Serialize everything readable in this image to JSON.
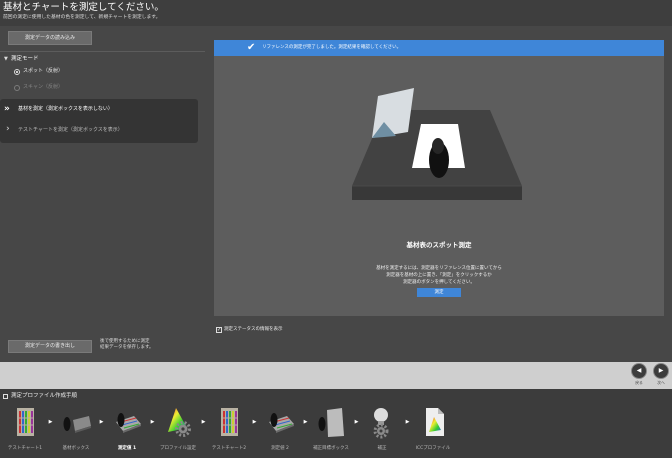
{
  "header": {
    "title": "基材とチャートを測定してください。",
    "subtitle": "前回の測定に使用した基材の色を測定して、新規チャートを測定します。"
  },
  "sidebar": {
    "load_button": "測定データの読み込み",
    "mode_section": {
      "title": "測定モード",
      "icon": "collapse-triangle-icon"
    },
    "modes": [
      {
        "label": "スポット（反射）",
        "selected": true,
        "enabled": true
      },
      {
        "label": "スキャン（反射）",
        "selected": false,
        "enabled": false
      }
    ],
    "tasks": [
      {
        "label": "基材を測定（測定ボックスを表示しない）",
        "icon": "double-chevron-right-icon",
        "active": true
      },
      {
        "label": "テストチャートを測定（測定ボックスを表示）",
        "icon": "chevron-right-icon",
        "active": false
      }
    ],
    "export_button": "測定データの書き出し",
    "export_note": [
      "後で使用するために測定",
      "結果データを保存します。"
    ]
  },
  "main": {
    "banner": {
      "icon": "check-icon",
      "text": "リファレンスの測定が完了しました。測定結果を確認してください。"
    },
    "illustration_icon": "substrate-measurement-illustration",
    "instruction": {
      "title": "基材表のスポット測定",
      "lines": [
        "基材を測定するには、測定器をリファレンス位置に置いてから",
        "測定器を基材の上に置き、「測定」をクリックするか",
        "測定器のボタンを押してください。"
      ]
    },
    "measure_button": "測定",
    "status_checkbox": {
      "label": "測定ステータスの情報を表示",
      "checked": true
    }
  },
  "navigation": {
    "back": {
      "label": "戻る",
      "icon": "arrow-left-icon"
    },
    "next": {
      "label": "次へ",
      "icon": "arrow-right-icon"
    }
  },
  "workflow": {
    "title": "測定プロファイル作成手順",
    "icon": "workflow-icon",
    "steps": [
      {
        "label": "テストチャート1",
        "icon": "test-chart-icon",
        "current": false
      },
      {
        "label": "基材ボックス",
        "icon": "substrate-box-icon",
        "current": false
      },
      {
        "label": "測定値 1",
        "icon": "measure-icon",
        "current": true
      },
      {
        "label": "プロファイル設定",
        "icon": "profile-settings-icon",
        "current": false
      },
      {
        "label": "テストチャート2",
        "icon": "test-chart-icon",
        "current": false
      },
      {
        "label": "測定値 2",
        "icon": "measure-icon",
        "current": false
      },
      {
        "label": "補正目標ボックス",
        "icon": "target-box-icon",
        "current": false
      },
      {
        "label": "補正",
        "icon": "correction-icon",
        "current": false
      },
      {
        "label": "ICCプロファイル",
        "icon": "icc-profile-icon",
        "current": false
      }
    ]
  },
  "colors": {
    "accent": "#3f86d8",
    "header_bg": "#3e3e3e",
    "body_bg": "#474747",
    "panel_bg": "#5d5d5d",
    "nav_bar_bg": "#cfcfcf"
  }
}
